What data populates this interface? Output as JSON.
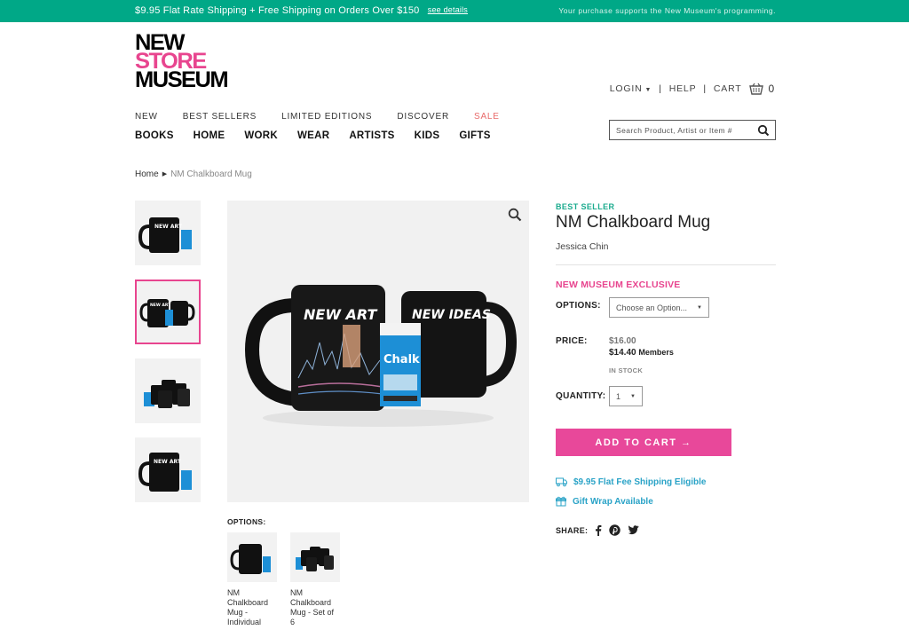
{
  "topbar": {
    "promo": "$9.95 Flat Rate Shipping + Free Shipping on Orders Over $150",
    "details_link": "see details",
    "support": "Your purchase supports the New Museum's programming."
  },
  "logo": {
    "line1": "NEW",
    "line2": "STORE",
    "line3": "MUSEUM"
  },
  "account": {
    "login": "LOGIN",
    "help": "HELP",
    "cart": "CART",
    "cart_count": "0"
  },
  "nav_primary": [
    "NEW",
    "BEST SELLERS",
    "LIMITED EDITIONS",
    "DISCOVER",
    "SALE"
  ],
  "nav_secondary": [
    "BOOKS",
    "HOME",
    "WORK",
    "WEAR",
    "ARTISTS",
    "KIDS",
    "GIFTS"
  ],
  "search": {
    "placeholder": "Search Product, Artist or Item #"
  },
  "breadcrumb": {
    "home": "Home",
    "current": "NM Chalkboard Mug"
  },
  "gallery": {
    "mug_text_1": "NEW ART",
    "mug_text_2": "NEW IDEAS",
    "chalk_text": "Chalk"
  },
  "options": {
    "label": "OPTIONS:",
    "items": [
      "NM Chalkboard Mug - Individual",
      "NM Chalkboard Mug - Set of 6"
    ]
  },
  "product": {
    "badge": "BEST SELLER",
    "title": "NM Chalkboard Mug",
    "artist": "Jessica Chin",
    "exclusive": "NEW MUSEUM EXCLUSIVE",
    "options_label": "OPTIONS:",
    "options_placeholder": "Choose an Option...",
    "price_label": "PRICE:",
    "price": "$16.00",
    "member_price": "$14.40",
    "member_label": "Members",
    "stock": "IN STOCK",
    "quantity_label": "QUANTITY:",
    "quantity": "1",
    "add_to_cart": "ADD TO CART →",
    "shipping_note": "$9.95 Flat Fee Shipping Eligible",
    "gift_wrap": "Gift Wrap Available",
    "share_label": "SHARE:"
  },
  "colors": {
    "accent_green": "#00a887",
    "accent_pink": "#e8458f",
    "link_blue": "#2aa3c7"
  }
}
